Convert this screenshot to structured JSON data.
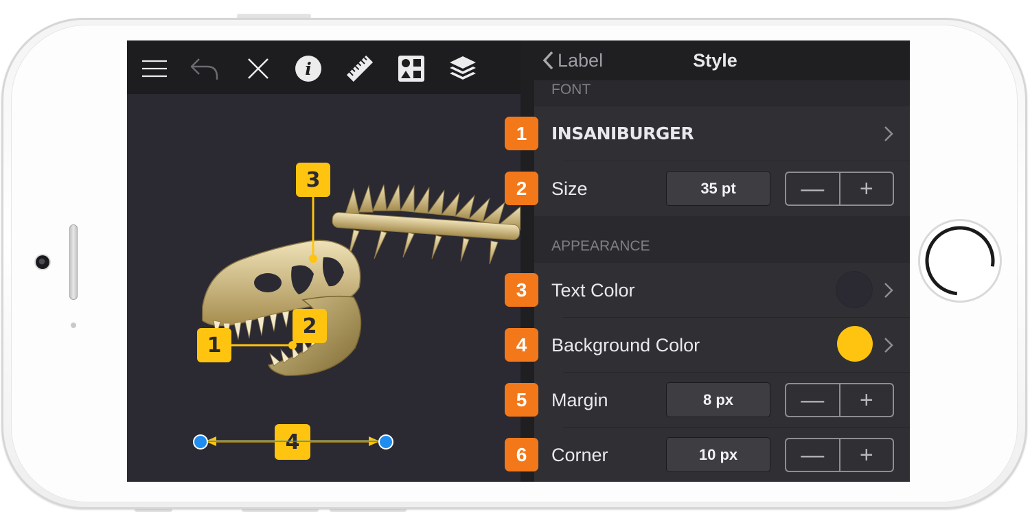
{
  "toolbar": {
    "icons": [
      "menu-icon",
      "undo-icon",
      "close-icon",
      "info-icon",
      "ruler-icon",
      "shapes-icon",
      "layers-icon"
    ]
  },
  "canvas": {
    "callouts": [
      {
        "number": "1"
      },
      {
        "number": "2"
      },
      {
        "number": "3"
      },
      {
        "number": "4"
      }
    ],
    "callout_color": "#fec40f",
    "handle_color": "#1f8cf0"
  },
  "panel": {
    "back_label": "Label",
    "title": "Style",
    "sections": {
      "font": "FONT",
      "appearance": "APPEARANCE"
    },
    "rows": {
      "font": {
        "badge": "1",
        "value": "INSANIBURGER"
      },
      "size": {
        "badge": "2",
        "label": "Size",
        "value": "35 pt",
        "minus": "—",
        "plus": "+"
      },
      "text_color": {
        "badge": "3",
        "label": "Text Color",
        "swatch": "#2b2a33"
      },
      "background_color": {
        "badge": "4",
        "label": "Background Color",
        "swatch": "#fec40f"
      },
      "margin": {
        "badge": "5",
        "label": "Margin",
        "value": "8 px",
        "minus": "—",
        "plus": "+"
      },
      "corner": {
        "badge": "6",
        "label": "Corner",
        "value": "10 px",
        "minus": "—",
        "plus": "+"
      }
    },
    "badge_color": "#f3781a"
  }
}
